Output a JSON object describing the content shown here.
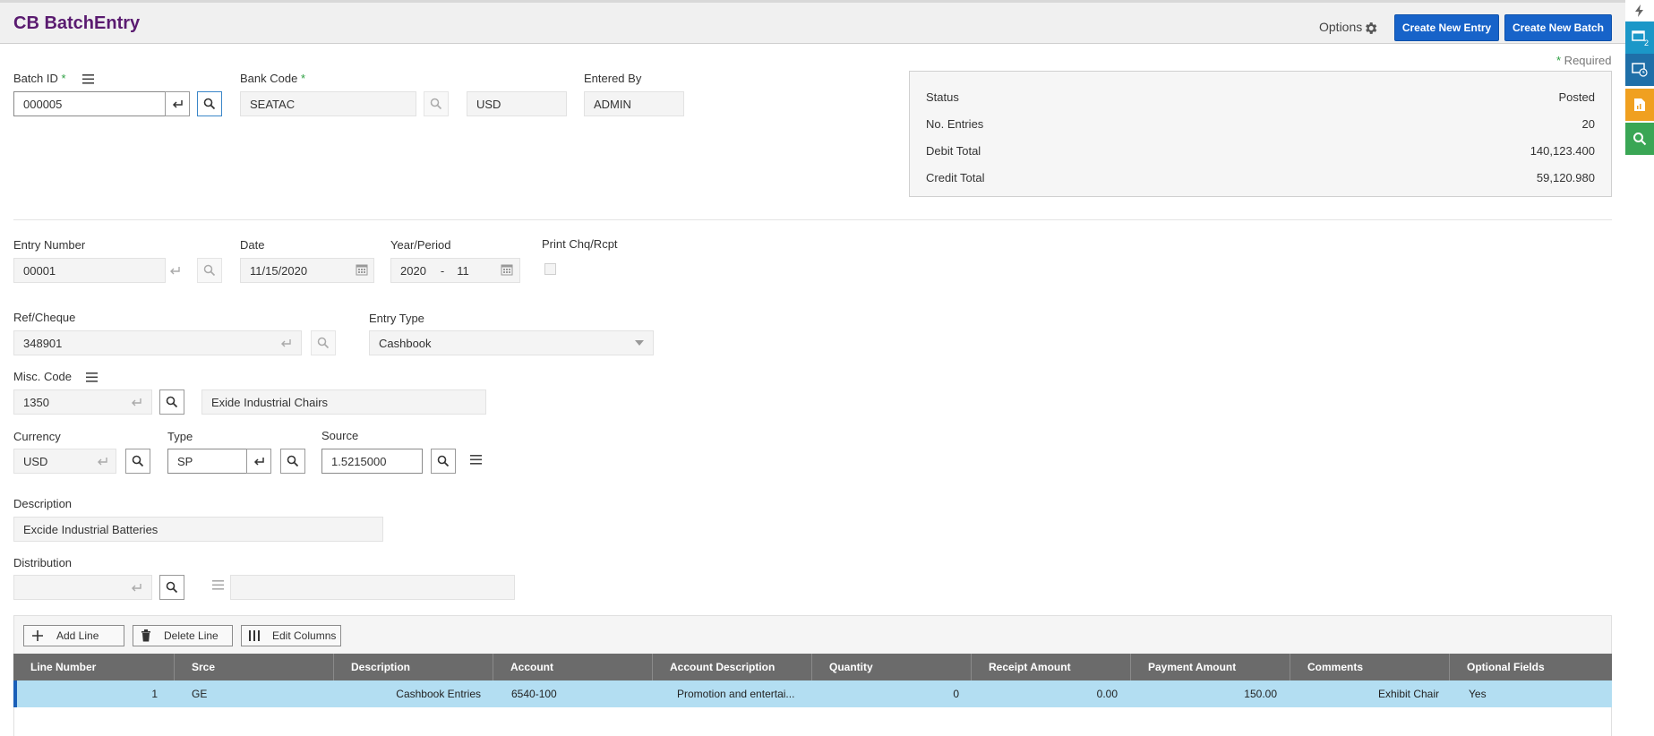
{
  "header": {
    "title": "CB BatchEntry",
    "options_label": "Options",
    "create_entry_label": "Create New Entry",
    "create_batch_label": "Create New Batch"
  },
  "sidebar": {
    "items": [
      {
        "icon": "lightning-icon"
      },
      {
        "icon": "windows-icon",
        "badge": "2",
        "color": "#1b97c8"
      },
      {
        "icon": "window-clock-icon",
        "color": "#1f6fa8"
      },
      {
        "icon": "report-icon",
        "color": "#f0a020"
      },
      {
        "icon": "search-icon",
        "color": "#3aa655"
      }
    ]
  },
  "required_note": "* Required",
  "batch": {
    "batch_id_label": "Batch ID",
    "batch_id_value": "000005",
    "bank_code_label": "Bank Code",
    "bank_code_value": "SEATAC",
    "currency_value": "USD",
    "entered_by_label": "Entered By",
    "entered_by_value": "ADMIN"
  },
  "summary": {
    "status_label": "Status",
    "status_value": "Posted",
    "entries_label": "No. Entries",
    "entries_value": "20",
    "debit_label": "Debit Total",
    "debit_value": "140,123.400",
    "credit_label": "Credit Total",
    "credit_value": "59,120.980"
  },
  "entry": {
    "entry_number_label": "Entry Number",
    "entry_number_value": "00001",
    "date_label": "Date",
    "date_value": "11/15/2020",
    "year_period_label": "Year/Period",
    "year_value": "2020",
    "period_sep": "-",
    "period_value": "11",
    "print_label": "Print Chq/Rcpt",
    "ref_label": "Ref/Cheque",
    "ref_value": "348901",
    "entry_type_label": "Entry Type",
    "entry_type_value": "Cashbook",
    "misc_label": "Misc. Code",
    "misc_value": "1350",
    "misc_desc_value": "Exide Industrial Chairs",
    "currency_label": "Currency",
    "currency_value": "USD",
    "type_label": "Type",
    "type_value": "SP",
    "source_label": "Source",
    "source_value": "1.5215000",
    "description_label": "Description",
    "description_value": "Excide Industrial Batteries",
    "distribution_label": "Distribution",
    "distribution_value": "",
    "distribution_desc_value": ""
  },
  "toolbar": {
    "add_line_label": "Add Line",
    "delete_line_label": "Delete Line",
    "edit_columns_label": "Edit Columns"
  },
  "grid": {
    "columns": [
      "Line Number",
      "Srce",
      "Description",
      "Account",
      "Account Description",
      "Quantity",
      "Receipt Amount",
      "Payment Amount",
      "Comments",
      "Optional Fields"
    ],
    "rows": [
      {
        "line_number": "1",
        "srce": "GE",
        "description": "Cashbook Entries",
        "account": "6540-100",
        "account_description": "Promotion and entertai...",
        "quantity": "0",
        "receipt_amount": "0.00",
        "payment_amount": "150.00",
        "comments": "Exhibit Chair",
        "optional_fields": "Yes"
      }
    ]
  },
  "colors": {
    "title": "#5a1b70",
    "primary_button": "#1763c9",
    "grid_header": "#6b6b6b",
    "selected_row": "#b3def2",
    "required_star": "#2ea043"
  }
}
